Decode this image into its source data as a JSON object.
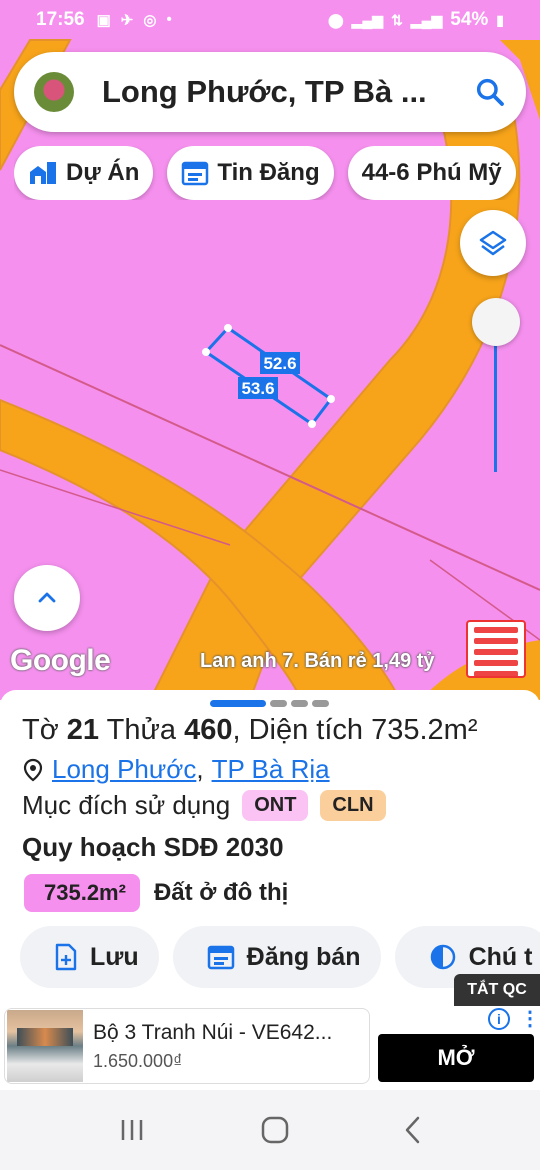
{
  "status_bar": {
    "time": "17:56",
    "battery": "54%"
  },
  "search": {
    "value": "Long Phước, TP Bà ..."
  },
  "chips": [
    {
      "label": "Dự Án",
      "icon": "building-icon"
    },
    {
      "label": "Tin Đăng",
      "icon": "calendar-icon"
    },
    {
      "label": "44-6 Phú Mỹ"
    }
  ],
  "map": {
    "parcel_labels": [
      "52.6",
      "53.6"
    ],
    "watermark": "Google",
    "ad_text": "Lan anh 7. Bán rẻ 1,49 tỷ",
    "fill_color": "#f590ee",
    "road_color": "#f7a41a"
  },
  "sheet": {
    "to_label": "Tờ",
    "to_value": "21",
    "thua_label": "Thửa",
    "thua_value": "460",
    "area_label": "Diện tích",
    "area_value": "735.2m²",
    "location_link_1": "Long Phước",
    "location_separator": ",",
    "location_link_2": "TP Bà Rịa",
    "purpose_label": "Mục đích sử dụng",
    "purpose_badges": [
      "ONT",
      "CLN"
    ],
    "planning_title": "Quy hoạch SDĐ 2030",
    "planning_area": "735.2m²",
    "planning_zone": "Đất ở đô thị",
    "actions": [
      {
        "label": "Lưu",
        "icon": "save-doc-icon"
      },
      {
        "label": "Đăng bán",
        "icon": "calendar-icon"
      },
      {
        "label": "Chú t",
        "icon": "contrast-icon"
      }
    ]
  },
  "ad": {
    "close_label": "TẮT QC",
    "title": "Bộ 3 Tranh Núi - VE642...",
    "price": "1.650.000₫",
    "open_label": "MỞ"
  }
}
